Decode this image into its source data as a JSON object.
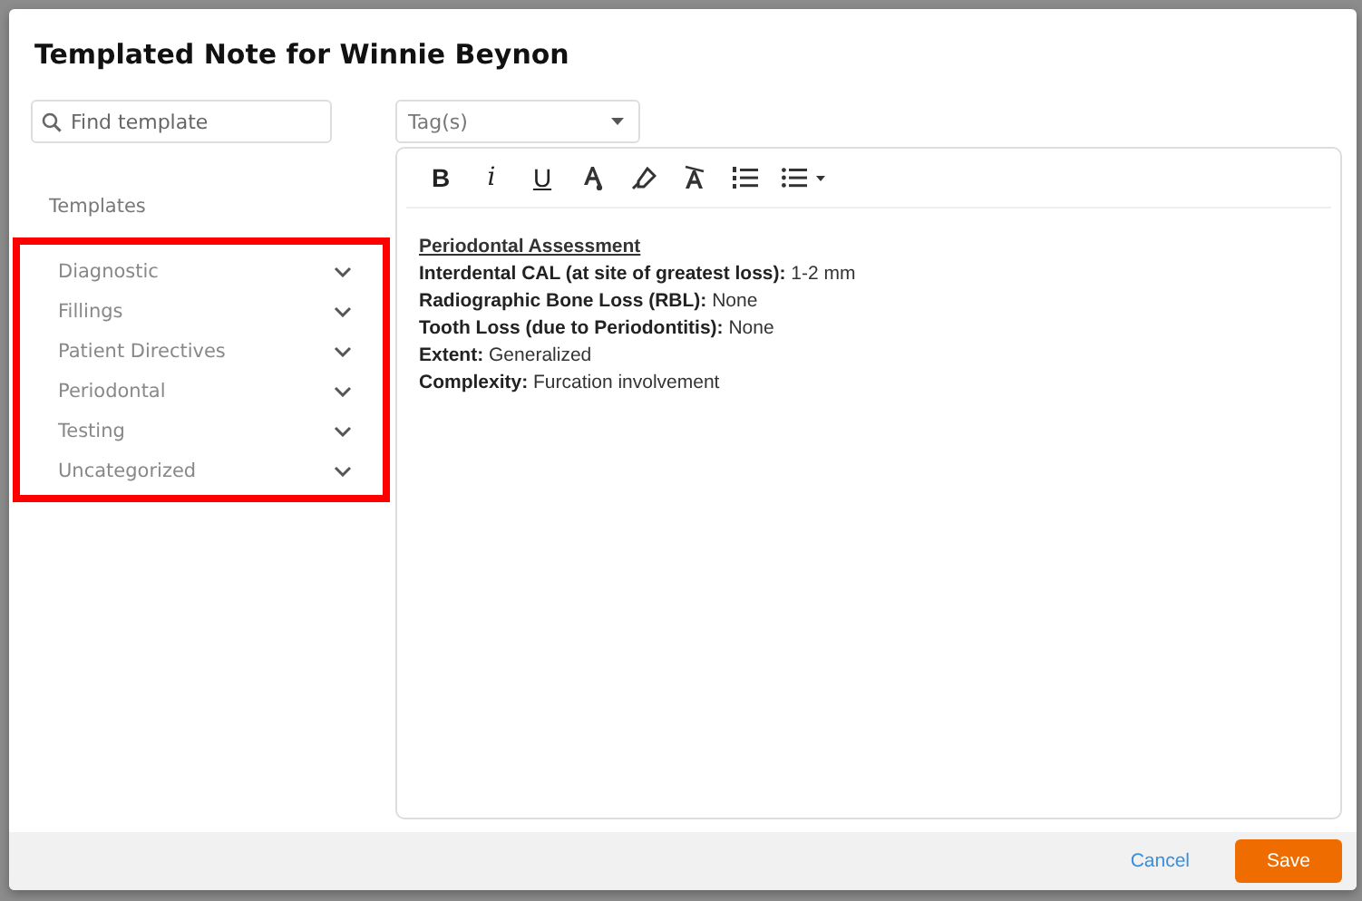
{
  "dialog": {
    "title": "Templated Note for Winnie Beynon"
  },
  "search": {
    "placeholder": "Find template"
  },
  "tags": {
    "placeholder": "Tag(s)"
  },
  "templates": {
    "heading": "Templates",
    "highlighted": true,
    "categories": [
      {
        "label": "Diagnostic",
        "expanded": false
      },
      {
        "label": "Fillings",
        "expanded": false
      },
      {
        "label": "Patient Directives",
        "expanded": false
      },
      {
        "label": "Periodontal",
        "expanded": false
      },
      {
        "label": "Testing",
        "expanded": false
      },
      {
        "label": "Uncategorized",
        "expanded": false
      }
    ]
  },
  "toolbar": [
    {
      "kind": "bold",
      "label": "B"
    },
    {
      "kind": "italic",
      "label": "i"
    },
    {
      "kind": "underline",
      "label": "U"
    },
    {
      "kind": "font-color"
    },
    {
      "kind": "highlight"
    },
    {
      "kind": "clear-format"
    },
    {
      "kind": "numbered-list"
    },
    {
      "kind": "bullet-list"
    }
  ],
  "note": [
    {
      "kind": "heading",
      "text": "Periodontal Assessment"
    },
    {
      "kind": "line",
      "text": "**Interdental CAL (at site of greatest loss):** 1-2 mm"
    },
    {
      "kind": "line",
      "text": "**Radiographic Bone Loss (RBL):** None"
    },
    {
      "kind": "line",
      "text": "**Tooth Loss (due to Periodontitis):** None"
    },
    {
      "kind": "line",
      "text": "**Extent:** Generalized"
    },
    {
      "kind": "line",
      "text": "**Complexity:** Furcation involvement"
    }
  ],
  "footer": {
    "cancel": "Cancel",
    "save": "Save"
  }
}
